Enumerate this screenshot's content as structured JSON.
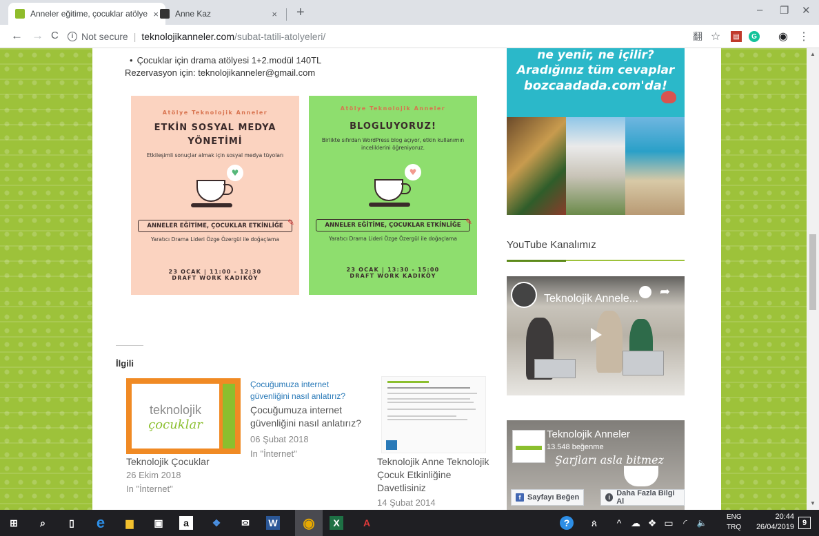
{
  "browser": {
    "tabs": [
      {
        "title": "Anneler eğitime, çocuklar atölye",
        "close": "×",
        "active": true,
        "favicon_color": "#8fbc2b"
      },
      {
        "title": "Anne Kaz",
        "close": "×",
        "active": false,
        "favicon_color": "#333333"
      }
    ],
    "new_tab": "+",
    "window_controls": {
      "minimize": "–",
      "restore": "❐",
      "close": "✕"
    },
    "nav": {
      "back": "←",
      "forward": "→",
      "reload": "C"
    },
    "address": {
      "info_icon": "i",
      "security_text": "Not secure",
      "separator": "|",
      "host": "teknolojikanneler.com",
      "path": "/subat-tatili-atolyeleri/"
    },
    "toolbar_icons": {
      "translate": "翻",
      "star": "☆",
      "pdf": "▤",
      "grammarly": "G",
      "account": "◉",
      "menu": "⋮"
    }
  },
  "article": {
    "bullet": "Çocuklar için drama atölyesi 1+2.modül 140TL",
    "reservation": "Rezervasyon için: teknolojikanneler@gmail.com",
    "posters": [
      {
        "eyebrow": "Atölye Teknolojik Anneler",
        "title_line1": "ETKİN SOSYAL MEDYA",
        "title_line2": "YÖNETİMİ",
        "subtitle": "Etkileşimli sonuçlar almak için sosyal medya tüyoları",
        "banner": "ANNELER EĞİTİME, ÇOCUKLAR ETKİNLİĞE",
        "leader": "Yaratıcı Drama Lideri Özge Özergül ile doğaçlama",
        "date": "23 OCAK | 11:00 - 12:30",
        "place": "DRAFT WORK KADIKÖY",
        "bg": "#fbd3c0",
        "eyebrow_color": "#d8734f",
        "bubble_icon": "♥",
        "bubble_color": "#56b87a"
      },
      {
        "eyebrow": "Atölye Teknolojik Anneler",
        "title_line1": "BLOGLUYORUZ!",
        "title_line2": "",
        "subtitle": "Birlikte sıfırdan WordPress blog açıyor, etkin kullanımın inceliklerini öğreniyoruz.",
        "banner": "ANNELER EĞİTİME, ÇOCUKLAR ETKİNLİĞE",
        "leader": "Yaratıcı Drama Lideri Özge Özergül ile doğaçlama",
        "date": "23 OCAK | 13:30 - 15:00",
        "place": "DRAFT WORK KADIKÖY",
        "bg": "#8ede6e",
        "eyebrow_color": "#d8734f",
        "bubble_icon": "♥",
        "bubble_color": "#f29a8e"
      }
    ],
    "pencil_icon": "✎"
  },
  "related": {
    "heading": "İlgili",
    "items": [
      {
        "thumb_text_1": "teknolojik",
        "thumb_text_2": "çocuklar",
        "title": "Teknolojik Çocuklar",
        "date": "26 Ekim 2018",
        "category": "In \"İnternet\""
      },
      {
        "alt_text": "Çocuğumuza internet güvenliğini nasıl anlatırız?",
        "title_l1": "Çocuğumuza internet",
        "title_l2": "güvenliğini nasıl anlatırız?",
        "date": "06 Şubat 2018",
        "category": "In \"İnternet\""
      },
      {
        "title_l1": "Teknolojik Anne Teknolojik",
        "title_l2": "Çocuk Etkinliğine",
        "title_l3": "Davetlisiniz",
        "date": "14 Şubat 2014"
      }
    ]
  },
  "sidebar": {
    "ad": {
      "line1": "ne yenir, ne içilir?",
      "line2": "Aradığınız tüm cevaplar",
      "line3": "bozcaadada.com'da!"
    },
    "youtube_heading": "YouTube Kanalımız",
    "youtube_video_title": "Teknolojik Annele...",
    "share_icon": "➦",
    "facebook": {
      "page_name": "Teknolojik Anneler",
      "likes": "13.548 beğenme",
      "script_text": "Şarjları asla bitmez",
      "like_button": "Sayfayı Beğen",
      "like_icon": "f",
      "info_button": "Daha Fazla Bilgi Al",
      "info_icon": "i"
    }
  },
  "scrollbar": {
    "up": "▲",
    "down": "▼"
  },
  "taskbar": {
    "apps": [
      {
        "name": "start",
        "glyph": "⊞",
        "color": "#ffffff"
      },
      {
        "name": "search",
        "glyph": "⌕",
        "color": "#ffffff"
      },
      {
        "name": "task-view",
        "glyph": "▯",
        "color": "#ffffff"
      },
      {
        "name": "edge",
        "glyph": "e",
        "color": "#2d8ee6"
      },
      {
        "name": "file-explorer",
        "glyph": "▆",
        "color": "#f3c12e"
      },
      {
        "name": "store",
        "glyph": "▣",
        "color": "#ffffff"
      },
      {
        "name": "amazon",
        "glyph": "a",
        "color": "#ffffff"
      },
      {
        "name": "dropbox",
        "glyph": "❖",
        "color": "#4a90e2"
      },
      {
        "name": "mail",
        "glyph": "✉",
        "color": "#ffffff"
      },
      {
        "name": "word",
        "glyph": "W",
        "color": "#2b5797"
      },
      {
        "name": "chrome",
        "glyph": "◉",
        "color": "#e8a900"
      },
      {
        "name": "excel",
        "glyph": "X",
        "color": "#1e7145"
      },
      {
        "name": "acrobat",
        "glyph": "A",
        "color": "#e03a3a"
      }
    ],
    "tray": {
      "help": "?",
      "people": "ጰ",
      "chevron": "^",
      "cloud": "☁",
      "dropbox": "❖",
      "battery": "▭",
      "wifi": "◜",
      "volume": "🔈"
    },
    "lang_l1": "ENG",
    "lang_l2": "TRQ",
    "time": "20:44",
    "date": "26/04/2019",
    "notifications": "9"
  }
}
